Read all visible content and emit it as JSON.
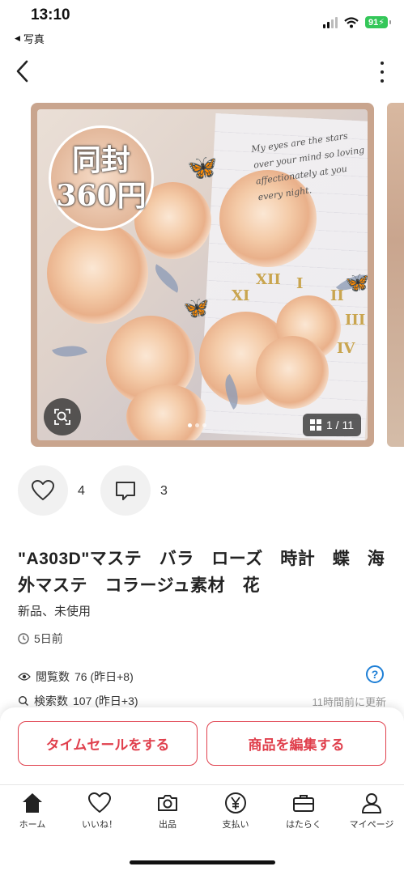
{
  "status": {
    "time": "13:10",
    "back_app": "写真",
    "battery": "91"
  },
  "image": {
    "badge_line1": "同封",
    "badge_line2": "360円",
    "counter": "1 / 11",
    "script_text": "My eyes are the stars over your mind so loving affectionately at you every night."
  },
  "social": {
    "likes": "4",
    "comments": "3"
  },
  "product": {
    "title": "\"A303D\"マステ　バラ　ローズ　時計　蝶　海外マステ　コラージュ素材　花",
    "condition": "新品、未使用",
    "posted": "5日前"
  },
  "stats": {
    "views_label": "閲覧数",
    "views_value": "76 (昨日+8)",
    "search_label": "検索数",
    "search_value": "107 (昨日+3)",
    "help": "?",
    "updated": "11時間前に更新"
  },
  "actions": {
    "timesale": "タイムセールをする",
    "edit": "商品を編集する"
  },
  "tabs": [
    {
      "label": "ホーム",
      "icon": "home-icon"
    },
    {
      "label": "いいね！",
      "icon": "heart-icon"
    },
    {
      "label": "出品",
      "icon": "camera-icon"
    },
    {
      "label": "支払い",
      "icon": "yen-icon"
    },
    {
      "label": "はたらく",
      "icon": "briefcase-icon"
    },
    {
      "label": "マイページ",
      "icon": "person-icon"
    }
  ],
  "colors": {
    "accent": "#e0404d",
    "link": "#1e7fd6",
    "battery": "#34c759"
  }
}
